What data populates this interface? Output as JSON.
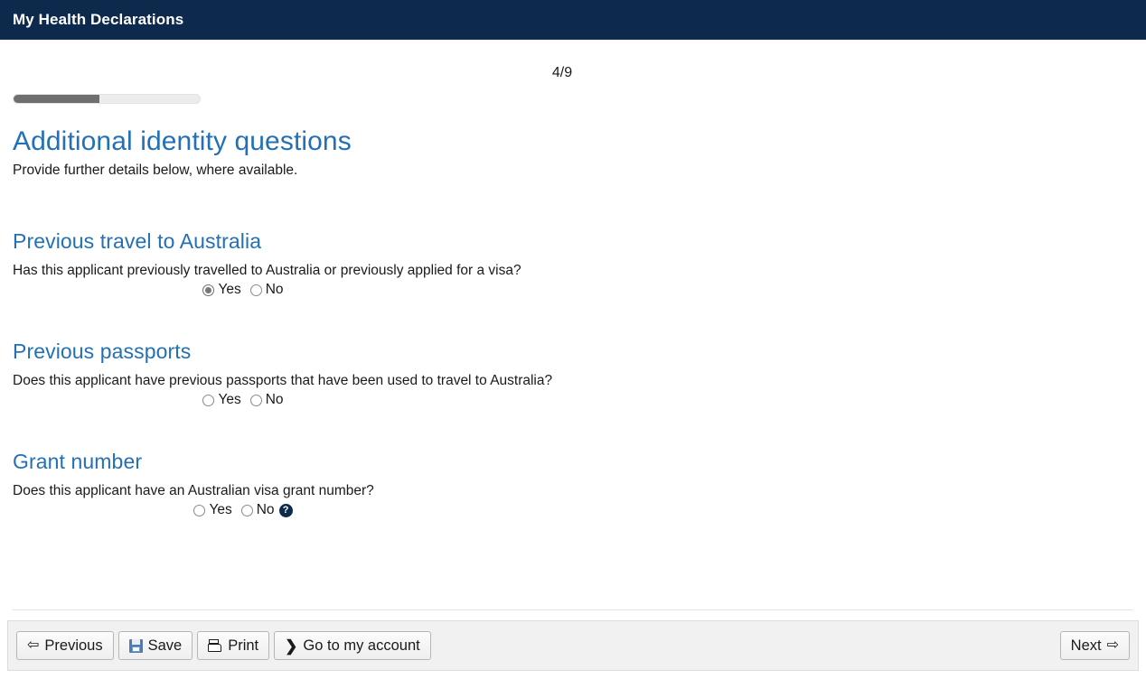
{
  "header": {
    "title": "My Health Declarations"
  },
  "progress": {
    "step_label": "4/9",
    "current_step": 4,
    "total_steps": 9,
    "percent": 46,
    "fill_color": "#6f6f6f",
    "track_color": "#ececec"
  },
  "page": {
    "title": "Additional identity questions",
    "subtitle": "Provide further details below, where available.",
    "heading_color": "#2470b5"
  },
  "sections": [
    {
      "title": "Previous travel to Australia",
      "question": "Has this applicant previously travelled to Australia or previously applied for a visa?",
      "options": [
        {
          "label": "Yes",
          "selected": true
        },
        {
          "label": "No",
          "selected": false
        }
      ],
      "help": null
    },
    {
      "title": "Previous passports",
      "question": "Does this applicant have previous passports that have been used to travel to Australia?",
      "options": [
        {
          "label": "Yes",
          "selected": false
        },
        {
          "label": "No",
          "selected": false
        }
      ],
      "help": null
    },
    {
      "title": "Grant number",
      "question": "Does this applicant have an Australian visa grant number?",
      "options": [
        {
          "label": "Yes",
          "selected": false
        },
        {
          "label": "No",
          "selected": false
        }
      ],
      "help": {
        "icon": "help-circle-icon",
        "glyph": "?",
        "color": "#0d2a4d"
      }
    }
  ],
  "toolbar": {
    "left_buttons": [
      {
        "label": "Previous",
        "icon": "arrow-left-icon",
        "glyph": "⇦"
      },
      {
        "label": "Save",
        "icon": "floppy-disk-icon",
        "glyph": ""
      },
      {
        "label": "Print",
        "icon": "printer-icon",
        "glyph": ""
      },
      {
        "label": "Go to my account",
        "icon": "chevron-right-icon",
        "glyph": "❯"
      }
    ],
    "right_buttons": [
      {
        "label": "Next",
        "icon": "arrow-right-icon",
        "glyph": "⇨"
      }
    ]
  }
}
